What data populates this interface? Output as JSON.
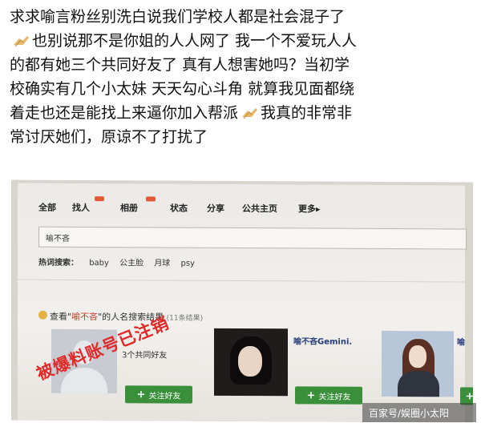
{
  "post": {
    "line1": "求求喻言粉丝别洗白说我们学校人都是社会混子了",
    "line2": "也别说那不是你姐的人人网了 我一个不爱玩人人",
    "line3": "的都有她三个共同好友了 真有人想害她吗？当初学",
    "line4": "校确实有几个小太妹 天天勾心斗角 就算我见面都绕",
    "line5": "着走也还是能找上来逼你加入帮派",
    "line5b": "我真的非常非",
    "line6": "常讨厌她们，原谅不了打扰了",
    "emoji_icon": "clapping-hands-icon"
  },
  "site": {
    "nav": [
      "全部",
      "找人",
      "相册",
      "状态",
      "分享",
      "公共主页",
      "更多▸"
    ],
    "search_value": "喻不吝",
    "hot_label": "热词搜索：",
    "hot_terms": [
      "baby",
      "公主脸",
      "月球",
      "psy"
    ],
    "result_title_prefix": "查看\"",
    "result_keyword": "喻不吝",
    "result_title_suffix": "\"的人名搜索结果",
    "result_count": "(11条结果)",
    "mutual_friends": "3个共同好友",
    "person2_name": "喻不吝Gemini.",
    "person3_name_cut": "喻",
    "follow_label": "关注好友"
  },
  "overlay": {
    "stamp": "被爆料账号已注销",
    "watermark": "百家号/娱圈小太阳"
  },
  "colors": {
    "stamp": "#e02a2a",
    "follow_button": "#3a8f3a",
    "keyword": "#c8382a"
  }
}
